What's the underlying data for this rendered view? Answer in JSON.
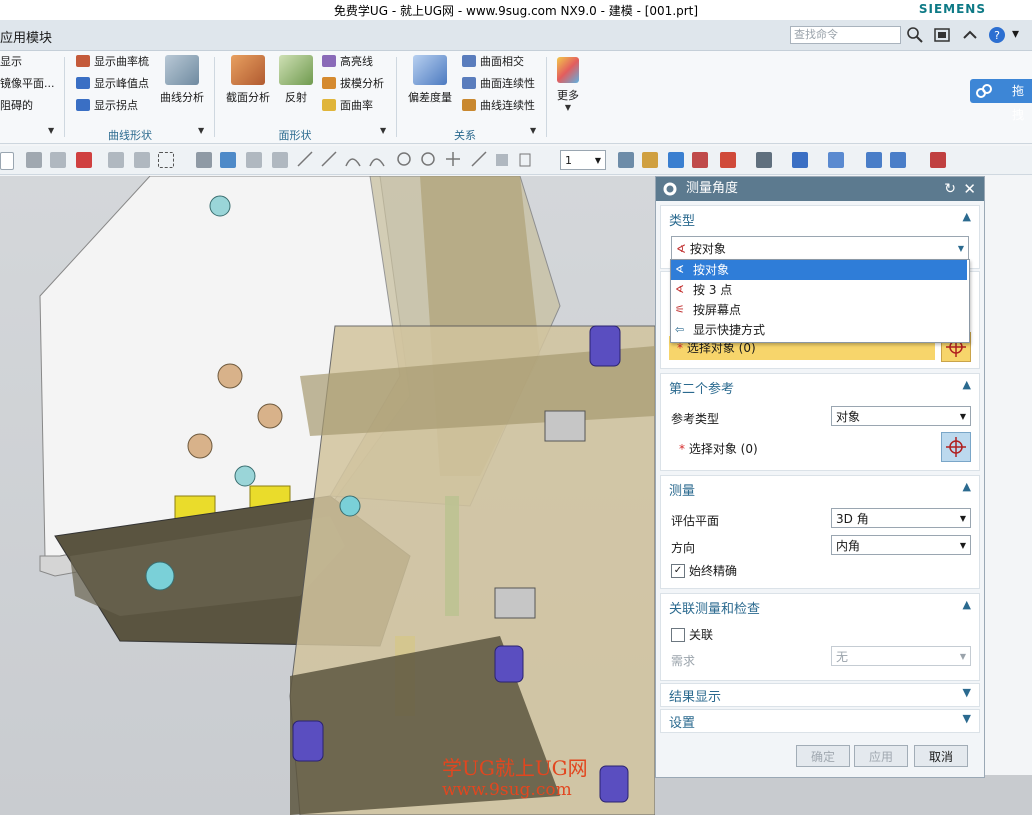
{
  "window": {
    "title": "免费学UG - 就上UG网 - www.9sug.com NX9.0 - 建模 - [001.prt]",
    "brand": "SIEMENS"
  },
  "menubar": {
    "app_module": "应用模块",
    "search_placeholder": "查找命令",
    "side_tab": "拖拽"
  },
  "ribbon": {
    "display_group": {
      "items": [
        "显示",
        "镜像平面...",
        "阻碍的"
      ]
    },
    "curve_shape": {
      "label": "曲线形状",
      "items": [
        "显示曲率梳",
        "显示峰值点",
        "显示拐点"
      ],
      "big": "曲线分析"
    },
    "face_shape": {
      "label": "面形状",
      "big": [
        "截面分析",
        "反射"
      ],
      "items": [
        "高亮线",
        "拔模分析",
        "面曲率"
      ]
    },
    "relation": {
      "label": "关系",
      "big": "偏差度量",
      "items": [
        "曲面相交",
        "曲面连续性",
        "曲线连续性"
      ]
    },
    "more": "更多"
  },
  "seltool": {
    "count_value": "1"
  },
  "dialog": {
    "title": "测量角度",
    "type_section": {
      "label": "类型",
      "value": "按对象"
    },
    "dropdown_options": [
      "按对象",
      "按 3 点",
      "按屏幕点",
      "显示快捷方式"
    ],
    "first_ref": {
      "select_label": "选择对象 (0)"
    },
    "second_ref": {
      "label": "第二个参考",
      "ref_type_label": "参考类型",
      "ref_type_value": "对象",
      "select_label": "选择对象 (0)"
    },
    "measure": {
      "label": "测量",
      "eval_plane_label": "评估平面",
      "eval_plane_value": "3D 角",
      "direction_label": "方向",
      "direction_value": "内角",
      "always_exact_label": "始终精确"
    },
    "assoc": {
      "label": "关联测量和检查",
      "assoc_label": "关联",
      "req_label": "需求",
      "req_value": "无"
    },
    "results_label": "结果显示",
    "settings_label": "设置",
    "ok": "确定",
    "apply": "应用",
    "cancel": "取消"
  },
  "watermark": {
    "line1": "学UG就上UG网",
    "line2": "www.9sug.com"
  },
  "colors": {
    "accent": "#2b6a8f",
    "dialog_title": "#5c7a8f",
    "selected": "#2f7dd8",
    "highlight": "#f7d56b"
  }
}
